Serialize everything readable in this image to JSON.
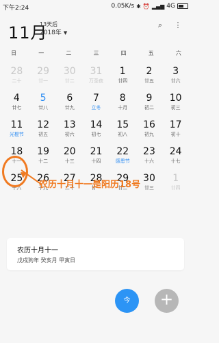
{
  "status": {
    "time": "下午2:24",
    "speed": "0.05K/s",
    "network": "4G",
    "signal": "signal-icon",
    "battery": "battery-icon"
  },
  "header": {
    "month": "11月",
    "days_later": "13天后",
    "year": "2018年"
  },
  "weekdays": [
    "日",
    "一",
    "二",
    "三",
    "四",
    "五",
    "六"
  ],
  "calendar": {
    "rows": [
      [
        {
          "day": "28",
          "lunar": "二十",
          "other": true
        },
        {
          "day": "29",
          "lunar": "廿一",
          "other": true
        },
        {
          "day": "30",
          "lunar": "廿二",
          "other": true
        },
        {
          "day": "31",
          "lunar": "万圣夜",
          "other": true
        },
        {
          "day": "1",
          "lunar": "廿四"
        },
        {
          "day": "2",
          "lunar": "廿五"
        },
        {
          "day": "3",
          "lunar": "廿六"
        }
      ],
      [
        {
          "day": "4",
          "lunar": "廿七"
        },
        {
          "day": "5",
          "lunar": "廿八",
          "today": true
        },
        {
          "day": "6",
          "lunar": "廿九"
        },
        {
          "day": "7",
          "lunar": "立冬",
          "blue": true
        },
        {
          "day": "8",
          "lunar": "十月"
        },
        {
          "day": "9",
          "lunar": "初二"
        },
        {
          "day": "10",
          "lunar": "初三"
        }
      ],
      [
        {
          "day": "11",
          "lunar": "光棍节",
          "blue": true
        },
        {
          "day": "12",
          "lunar": "初五"
        },
        {
          "day": "13",
          "lunar": "初六"
        },
        {
          "day": "14",
          "lunar": "初七"
        },
        {
          "day": "15",
          "lunar": "初八"
        },
        {
          "day": "16",
          "lunar": "初九"
        },
        {
          "day": "17",
          "lunar": "初十"
        }
      ],
      [
        {
          "day": "18",
          "lunar": "十一"
        },
        {
          "day": "19",
          "lunar": "十二"
        },
        {
          "day": "20",
          "lunar": "十三"
        },
        {
          "day": "21",
          "lunar": "十四"
        },
        {
          "day": "22",
          "lunar": "感恩节",
          "blue": true
        },
        {
          "day": "23",
          "lunar": "十六"
        },
        {
          "day": "24",
          "lunar": "十七"
        }
      ],
      [
        {
          "day": "25",
          "lunar": "十八"
        },
        {
          "day": "26",
          "lunar": "十九"
        },
        {
          "day": "27",
          "lunar": "二十"
        },
        {
          "day": "28",
          "lunar": "廿一"
        },
        {
          "day": "29",
          "lunar": "廿二"
        },
        {
          "day": "30",
          "lunar": "廿三"
        },
        {
          "day": "1",
          "lunar": "廿四",
          "other": true
        }
      ]
    ]
  },
  "annotation": "农历十月十一是阳历18号",
  "card": {
    "title": "农历十月十一",
    "detail": "戊戌狗年 癸亥月 甲寅日"
  },
  "fab": {
    "today_label": "今",
    "add_label": "+"
  },
  "colors": {
    "accent": "#2a8bf2",
    "annotation": "#f07a21"
  }
}
